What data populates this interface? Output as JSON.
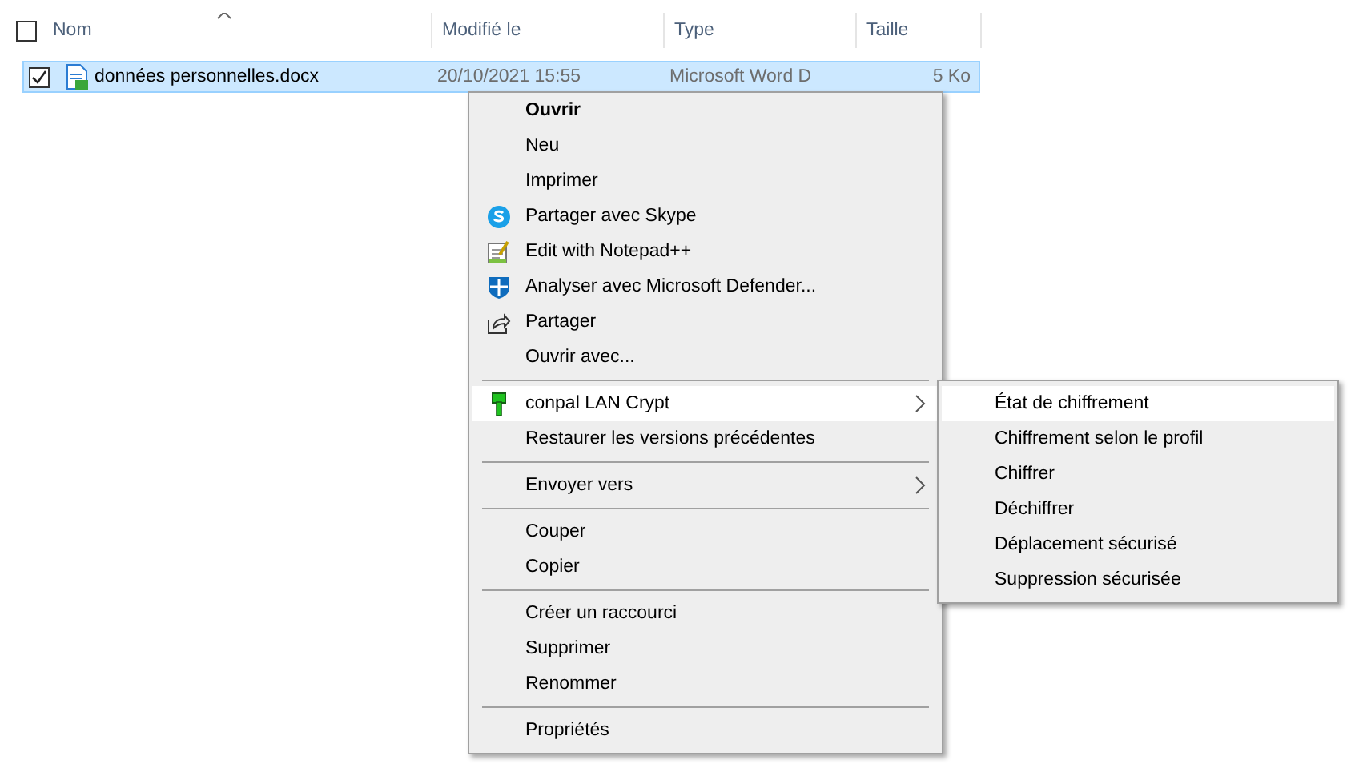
{
  "columns": [
    {
      "label": "Nom",
      "checked": false,
      "sorted": true
    },
    {
      "label": "Modifié le"
    },
    {
      "label": "Type"
    },
    {
      "label": "Taille"
    }
  ],
  "file": {
    "name": "données personnelles.docx",
    "modified": "20/10/2021 15:55",
    "type": "Microsoft Word D",
    "size": "5 Ko",
    "checked": true,
    "selected": true
  },
  "context_menu": [
    {
      "kind": "item",
      "label": "Ouvrir",
      "bold": true,
      "selected": false
    },
    {
      "kind": "item",
      "label": "Neu",
      "selected": false
    },
    {
      "kind": "item",
      "label": "Imprimer",
      "selected": false
    },
    {
      "kind": "item",
      "label": "Partager avec Skype",
      "selected": false
    },
    {
      "kind": "item",
      "label": "Edit with Notepad++",
      "selected": false
    },
    {
      "kind": "item",
      "label": "Analyser avec Microsoft Defender...",
      "selected": false
    },
    {
      "kind": "item",
      "label": "Partager",
      "selected": false
    },
    {
      "kind": "item",
      "label": "Ouvrir avec...",
      "selected": false
    },
    {
      "kind": "separator"
    },
    {
      "kind": "submenu",
      "label": "conpal LAN Crypt",
      "selected": true
    },
    {
      "kind": "item",
      "label": "Restaurer les versions précédentes",
      "selected": false
    },
    {
      "kind": "separator"
    },
    {
      "kind": "submenu",
      "label": "Envoyer vers",
      "selected": false
    },
    {
      "kind": "separator"
    },
    {
      "kind": "item",
      "label": "Couper",
      "selected": false
    },
    {
      "kind": "item",
      "label": "Copier",
      "selected": false
    },
    {
      "kind": "separator"
    },
    {
      "kind": "item",
      "label": "Créer un raccourci",
      "selected": false
    },
    {
      "kind": "item",
      "label": "Supprimer",
      "selected": false
    },
    {
      "kind": "item",
      "label": "Renommer",
      "selected": false
    },
    {
      "kind": "separator"
    },
    {
      "kind": "item",
      "label": "Propriétés",
      "selected": false
    }
  ],
  "submenu": [
    {
      "label": "État de chiffrement",
      "selected": true
    },
    {
      "label": "Chiffrement selon le profil",
      "selected": false
    },
    {
      "label": "Chiffrer",
      "selected": false
    },
    {
      "label": "Déchiffrer",
      "selected": false
    },
    {
      "label": "Déplacement sécurisé",
      "selected": false
    },
    {
      "label": "Suppression sécurisée",
      "selected": false
    }
  ]
}
